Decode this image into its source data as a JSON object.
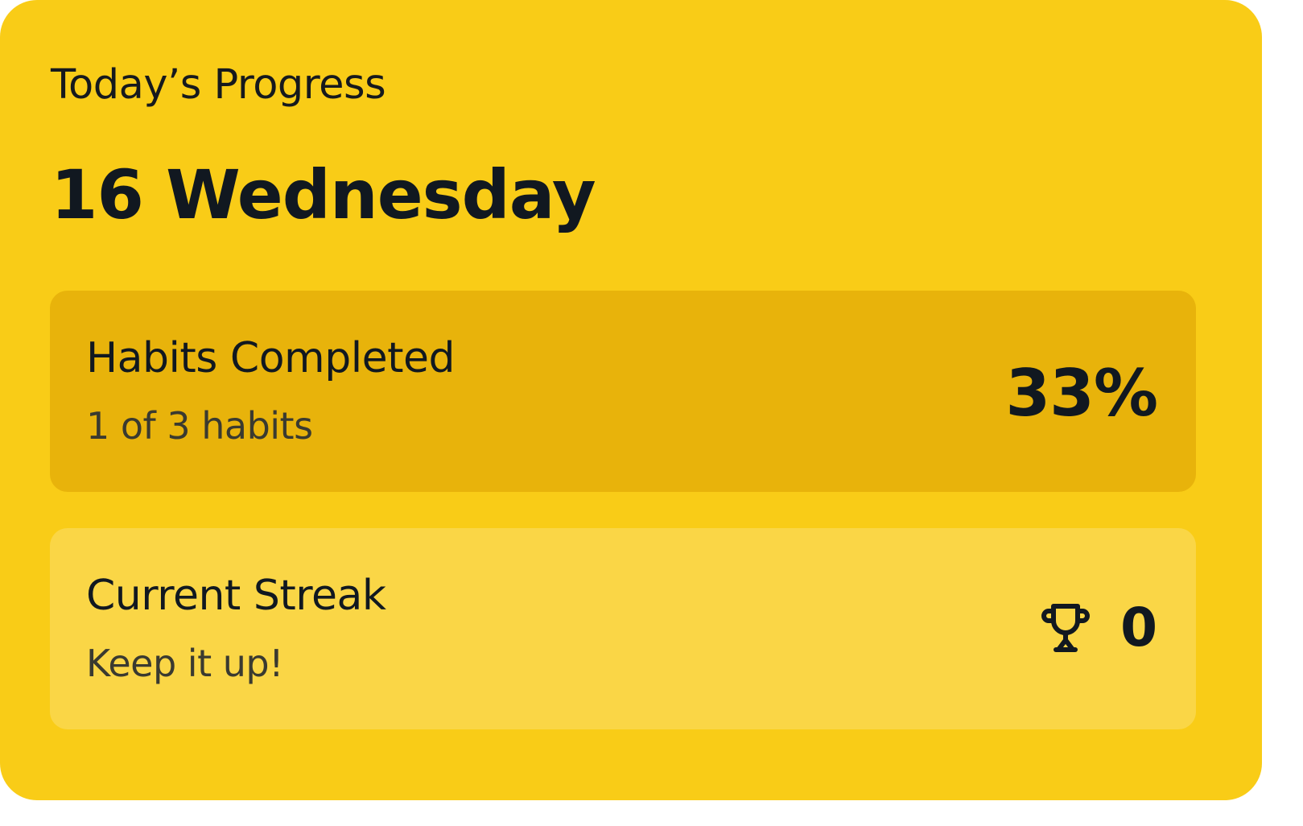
{
  "card": {
    "eyebrow": "Today’s Progress",
    "date": "16 Wednesday"
  },
  "habits": {
    "title": "Habits Completed",
    "subtitle": "1 of 3 habits",
    "percent": "33%"
  },
  "streak": {
    "title": "Current Streak",
    "subtitle": "Keep it up!",
    "icon": "trophy-icon",
    "count": "0"
  },
  "colors": {
    "card_bg": "#F9CC17",
    "habits_panel_bg": "#E8B30B",
    "streak_panel_bg": "#FAD646",
    "text_primary": "#111820"
  }
}
